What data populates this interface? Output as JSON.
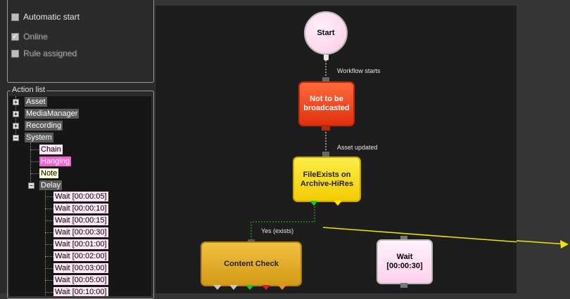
{
  "settings": {
    "automatic_start": {
      "label": "Automatic start",
      "checked": false
    },
    "online": {
      "label": "Online",
      "checked": true
    },
    "rule_assigned": {
      "label": "Rule assigned",
      "checked": false
    }
  },
  "action_list": {
    "title": "Action list",
    "categories": [
      {
        "label": "Asset",
        "expanded": false
      },
      {
        "label": "MediaManager",
        "expanded": false
      },
      {
        "label": "Recording",
        "expanded": false
      },
      {
        "label": "System",
        "expanded": true
      }
    ],
    "system_items": [
      "Chain",
      "Hanging",
      "Note"
    ],
    "delay": {
      "label": "Delay",
      "items": [
        "Wait [00:00:05]",
        "Wait [00:00:10]",
        "Wait [00:00:15]",
        "Wait [00:00:30]",
        "Wait [00:01:00]",
        "Wait [00:02:00]",
        "Wait [00:03:00]",
        "Wait [00:05:00]",
        "Wait [00:10:00]"
      ]
    }
  },
  "workflow": {
    "start": "Start",
    "edge_workflow_starts": "Workflow starts",
    "not_broadcasted": "Not to be broadcasted",
    "edge_asset_updated": "Asset updated",
    "file_exists": "FileExists on Archive-HiRes",
    "edge_yes_exists": "Yes (exists)",
    "content_check": "Content Check",
    "wait": "Wait [00:00:30]"
  },
  "colors": {
    "start_fill": "#ffd6f1",
    "red_node": "#f03a18",
    "yellow_node": "#f7d600",
    "orange_node": "#e0a820",
    "wait_fill": "#ffd6f1",
    "connector_green": "#22c422",
    "arrow_yellow": "#f2e600"
  }
}
